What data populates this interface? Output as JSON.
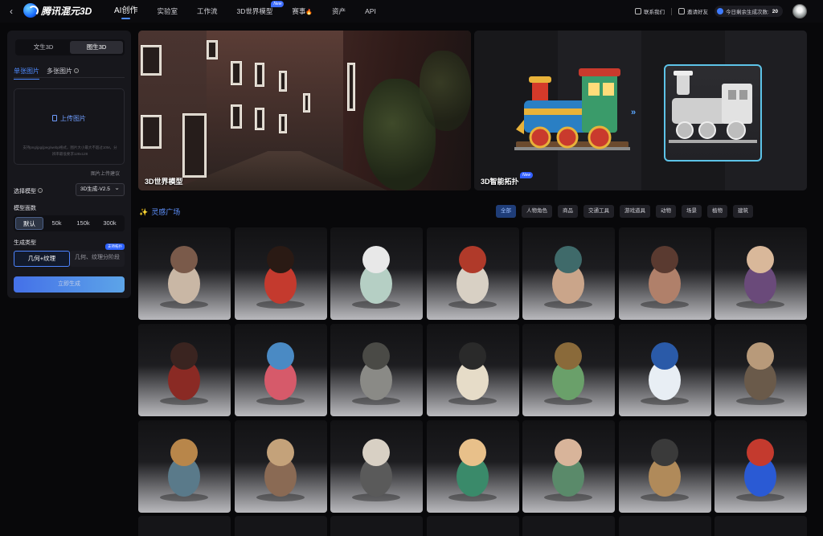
{
  "topbar": {
    "back_glyph": "‹",
    "brand": "腾讯混元3D",
    "nav": [
      {
        "label": "AI创作",
        "active": true
      },
      {
        "label": "实验室",
        "active": false
      },
      {
        "label": "工作流",
        "active": false
      },
      {
        "label": "3D世界模型",
        "active": false,
        "badge": "New"
      },
      {
        "label": "赛事",
        "active": false,
        "icon": "fire-icon"
      },
      {
        "label": "资产",
        "active": false
      },
      {
        "label": "API",
        "active": false
      }
    ],
    "contact": "联系我们",
    "invite": "邀请好友",
    "remaining_label": "今日剩余生成次数:",
    "remaining_count": "20"
  },
  "panel": {
    "mode_tabs": [
      "文生3D",
      "图生3D"
    ],
    "active_mode": "图生3D",
    "image_tabs": [
      "单张图片",
      "多张图片"
    ],
    "upload_label": "上传图片",
    "upload_hint": "支持png/jpg/jpeg/webp格式，图片大小最大不超过10M，分辨率最低要求128x128",
    "upload_tip": "图片上传建议",
    "model_label": "选择模型",
    "model_value": "3D生成-V2.5",
    "faces_label": "模型面数",
    "faces_options": [
      "默认",
      "50k",
      "150k",
      "300k"
    ],
    "faces_selected": "默认",
    "gen_type_label": "生成类型",
    "gen_type_options": [
      "几何+纹理",
      "几何、纹理分阶段"
    ],
    "gen_type_badge": "支持拓扑",
    "generate_button": "立即生成"
  },
  "banners": [
    {
      "title": "3D世界模型"
    },
    {
      "title": "3D智能拓扑",
      "badge": "New",
      "arrow": "»"
    }
  ],
  "gallery": {
    "title": "灵感广场",
    "filters": [
      "全部",
      "人物角色",
      "商品",
      "交通工具",
      "游戏道具",
      "动物",
      "场景",
      "植物",
      "建筑"
    ],
    "active_filter": "全部",
    "items": [
      "dragon-boy-figure",
      "dragon-plate",
      "silver-car",
      "feather-dagger",
      "staff-girl-figure",
      "fox-mask",
      "purple-hood-girl",
      "demon-mask",
      "opera-headdress",
      "bronze-dog",
      "captain-cat-figure",
      "grape-tree",
      "porcelain-horse-head",
      "mechanical-music-box",
      "steampunk-robot",
      "carved-mask",
      "skull-character",
      "scholar-figure",
      "leaf-boy-figure",
      "woven-basket",
      "blue-robot-bug"
    ]
  },
  "colors": {
    "accent": "#4e8cff",
    "page_bg": "#08080a",
    "panel_bg": "#17171c",
    "highlight_border": "#5dc3e8"
  }
}
